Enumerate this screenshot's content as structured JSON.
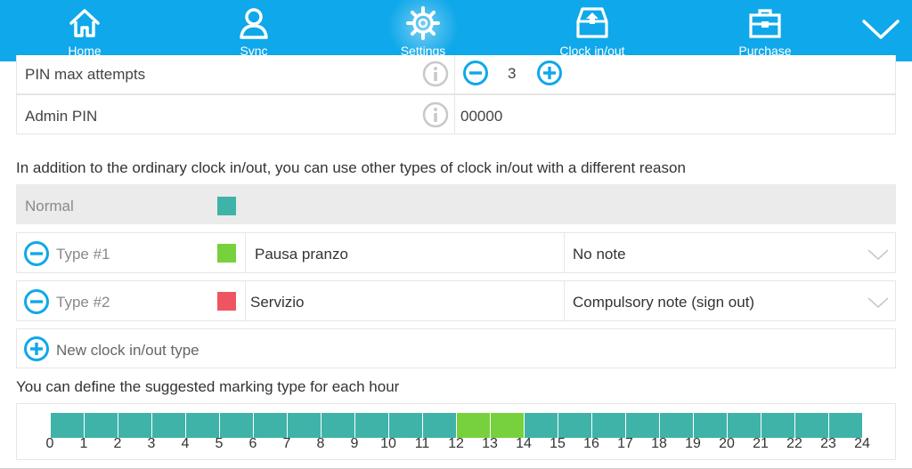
{
  "nav": {
    "items": [
      {
        "name": "home",
        "label": "Home",
        "icon": "home-icon"
      },
      {
        "name": "sync",
        "label": "Sync",
        "icon": "user-icon"
      },
      {
        "name": "settings",
        "label": "Settings",
        "icon": "gear-icon",
        "active": true
      },
      {
        "name": "clock",
        "label": "Clock in/out",
        "icon": "clock-in-out-icon"
      },
      {
        "name": "purchase",
        "label": "Purchase",
        "icon": "briefcase-icon"
      }
    ],
    "menu_icon": "chevron-down-icon",
    "bar_color": "#0fa8ea"
  },
  "settings": {
    "pin_max_attempts": {
      "label": "PIN max attempts",
      "value": "3"
    },
    "admin_pin": {
      "label": "Admin PIN",
      "value": "00000"
    }
  },
  "clock_types": {
    "intro": "In addition to the ordinary clock in/out, you can use other types of clock in/out with a different reason",
    "normal": {
      "label": "Normal",
      "color": "#3fb3a8"
    },
    "types": [
      {
        "label": "Type #1",
        "color": "#77d13d",
        "reason": "Pausa pranzo",
        "note": "No note"
      },
      {
        "label": "Type #2",
        "color": "#ef5560",
        "reason": "Servizio",
        "note": "Compulsory note (sign out)"
      }
    ],
    "new_type_label": "New clock in/out type"
  },
  "hours": {
    "intro": "You can define the suggested marking type for each hour",
    "labels": [
      "0",
      "1",
      "2",
      "3",
      "4",
      "5",
      "6",
      "7",
      "8",
      "9",
      "10",
      "11",
      "12",
      "13",
      "14",
      "15",
      "16",
      "17",
      "18",
      "19",
      "20",
      "21",
      "22",
      "23",
      "24"
    ],
    "cell_types": [
      "normal",
      "normal",
      "normal",
      "normal",
      "normal",
      "normal",
      "normal",
      "normal",
      "normal",
      "normal",
      "normal",
      "normal",
      "type1",
      "type1",
      "normal",
      "normal",
      "normal",
      "normal",
      "normal",
      "normal",
      "normal",
      "normal",
      "normal",
      "normal"
    ],
    "colors": {
      "normal": "#3fb3a8",
      "type1": "#77d13d"
    }
  }
}
